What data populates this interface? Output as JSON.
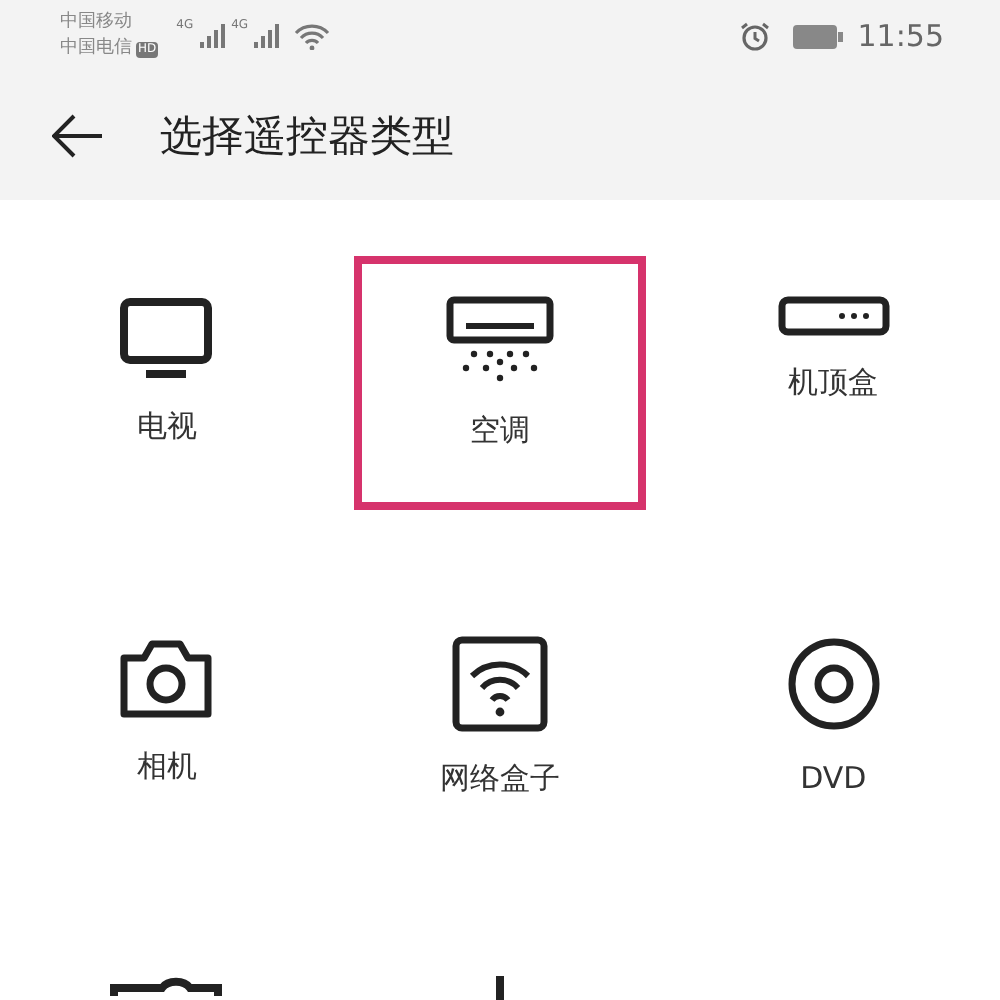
{
  "status_bar": {
    "carriers": [
      "中国移动",
      "中国电信"
    ],
    "hd_badge": "HD",
    "signals": [
      "4G",
      "4G"
    ],
    "time": "11:55"
  },
  "header": {
    "title": "选择遥控器类型"
  },
  "devices": [
    {
      "kind": "tv",
      "label": "电视",
      "selected": false
    },
    {
      "kind": "ac",
      "label": "空调",
      "selected": true
    },
    {
      "kind": "settop",
      "label": "机顶盒",
      "selected": false
    },
    {
      "kind": "camera",
      "label": "相机",
      "selected": false
    },
    {
      "kind": "wifi",
      "label": "网络盒子",
      "selected": false
    },
    {
      "kind": "dvd",
      "label": "DVD",
      "selected": false
    },
    {
      "kind": "projector",
      "selected": false
    },
    {
      "kind": "fan",
      "selected": false
    }
  ]
}
